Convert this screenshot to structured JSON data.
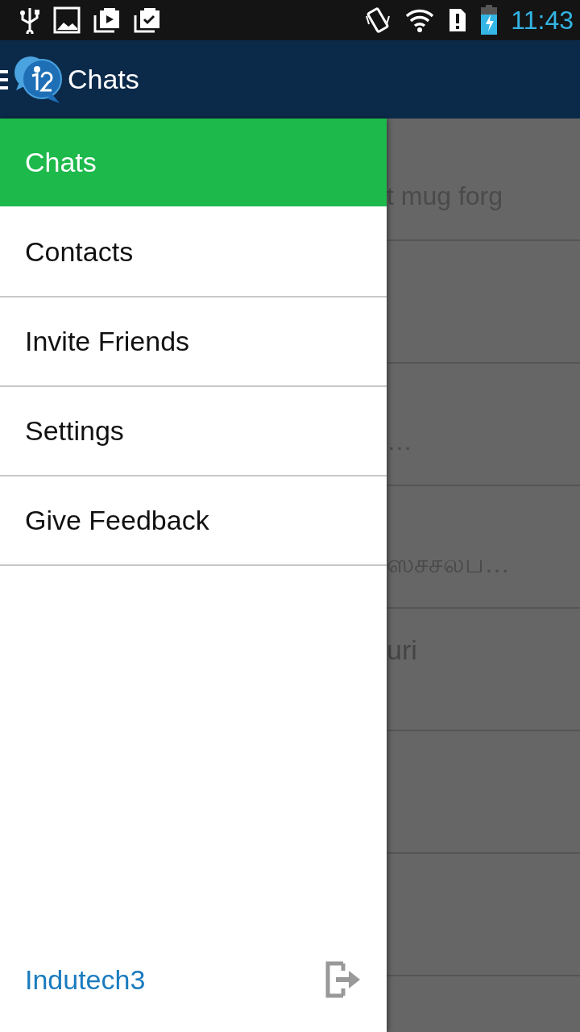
{
  "status_bar": {
    "time": "11:43"
  },
  "app_bar": {
    "title": "Chats"
  },
  "background_rows": [
    {
      "message": "t mug forg"
    },
    {},
    {
      "message": "…"
    },
    {
      "message": "ஸசசலப…"
    },
    {
      "name": "uri"
    },
    {},
    {},
    {}
  ],
  "drawer": {
    "items": [
      {
        "label": "Chats",
        "selected": true
      },
      {
        "label": "Contacts",
        "selected": false
      },
      {
        "label": "Invite Friends",
        "selected": false
      },
      {
        "label": "Settings",
        "selected": false
      },
      {
        "label": "Give Feedback",
        "selected": false
      }
    ],
    "account": "Indutech3"
  }
}
